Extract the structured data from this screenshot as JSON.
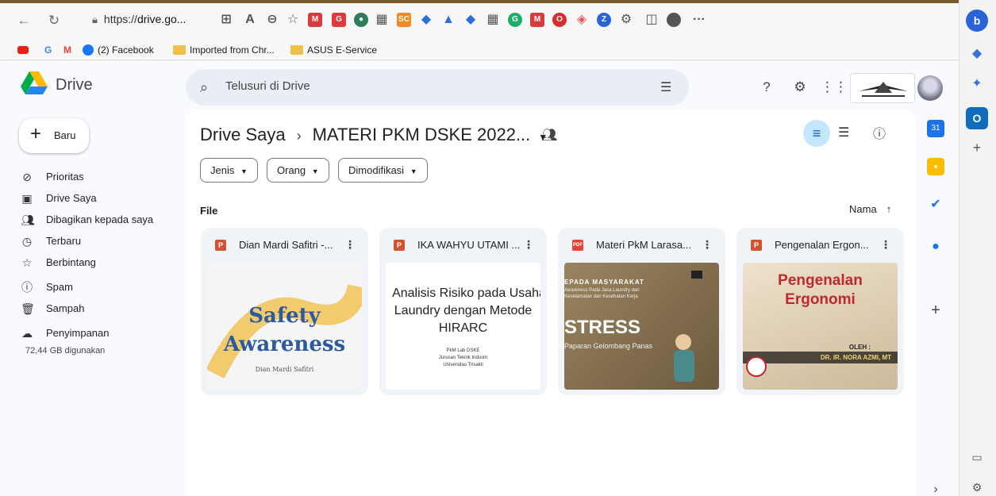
{
  "browser": {
    "url_prefix": "https://",
    "url_bold": "drive.go...",
    "more": "···",
    "bookmarks": [
      {
        "label": "G"
      },
      {
        "label": "M"
      },
      {
        "label": "(2) Facebook"
      },
      {
        "label": "Imported from Chr..."
      },
      {
        "label": "ASUS E-Service"
      }
    ]
  },
  "drive": {
    "title": "Drive",
    "search_placeholder": "Telusuri di Drive",
    "new_label": "Baru",
    "sidebar": [
      {
        "label": "Prioritas",
        "icon": "priority-icon"
      },
      {
        "label": "Drive Saya",
        "icon": "my-drive-icon"
      },
      {
        "label": "Dibagikan kepada saya",
        "icon": "shared-icon"
      },
      {
        "label": "Terbaru",
        "icon": "clock-icon"
      },
      {
        "label": "Berbintang",
        "icon": "star-icon"
      },
      {
        "label": "Spam",
        "icon": "spam-icon"
      },
      {
        "label": "Sampah",
        "icon": "trash-icon"
      },
      {
        "label": "Penyimpanan",
        "icon": "cloud-icon"
      }
    ],
    "storage_text": "72,44 GB digunakan",
    "breadcrumb": {
      "root": "Drive Saya",
      "sep": "›",
      "current": "MATERI PKM DSKE 2022..."
    },
    "filters": [
      "Jenis",
      "Orang",
      "Dimodifikasi"
    ],
    "section_label": "File",
    "sort_label": "Nama",
    "files": [
      {
        "name": "Dian Mardi Safitri -...",
        "type": "P",
        "color": "#d35230",
        "thumb": {
          "line1": "Safety",
          "line2": "Awareness",
          "author": "Dian Mardi Safitri"
        }
      },
      {
        "name": "IKA WAHYU UTAMI ...",
        "type": "P",
        "color": "#d35230",
        "thumb": {
          "line1": "Analisis Risiko pada Usaha",
          "line2": "Laundry dengan Metode",
          "line3": "HIRARC",
          "sub1": "PkM Lab DSKE",
          "sub2": "Jurusan Teknik Industri",
          "sub3": "Universitas Trisakti"
        }
      },
      {
        "name": "Materi PkM Larasa...",
        "type": "PDF",
        "color": "#ea4335",
        "thumb": {
          "top": "EPADA MASYARAKAT",
          "small1": "Awareness Pada Jasa Laundry dan",
          "small2": "Keselamatan dan Kesehatan Kerja",
          "big": "STRESS",
          "sub": "Paparan Gelombang Panas"
        }
      },
      {
        "name": "Pengenalan Ergon...",
        "type": "P",
        "color": "#d35230",
        "thumb": {
          "line1": "Pengenalan",
          "line2": "Ergonomi",
          "oleh": "OLEH :",
          "author": "DR. IR. NORA AZMI, MT"
        }
      }
    ]
  }
}
